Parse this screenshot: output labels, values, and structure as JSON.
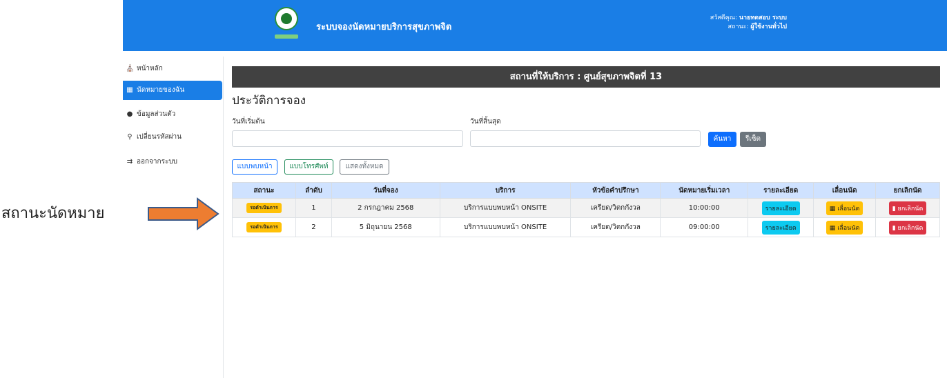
{
  "header": {
    "app_title": "ระบบจองนัดหมายบริการสุขภาพจิต",
    "greeting_label": "สวัสดีคุณ:",
    "user_name": "นายทดสอบ ระบบ",
    "status_label": "สถานะ:",
    "user_role": "ผู้ใช้งานทั่วไป",
    "brand_color": "#1a7ee6"
  },
  "sidebar": {
    "items": [
      {
        "label": "หน้าหลัก",
        "icon": "home-icon"
      },
      {
        "label": "นัดหมายของฉัน",
        "icon": "calendar-icon",
        "active": true
      },
      {
        "label": "ข้อมูลส่วนตัว",
        "icon": "user-icon"
      },
      {
        "label": "เปลี่ยนรหัสผ่าน",
        "icon": "key-icon"
      },
      {
        "label": "ออกจากระบบ",
        "icon": "logout-icon"
      }
    ]
  },
  "main": {
    "place_title": "สถานที่ให้บริการ : ศูนย์สุขภาพจิตที่ 13",
    "page_title": "ประวัติการจอง",
    "start_date_label": "วันที่เริ่มต้น",
    "end_date_label": "วันที่สิ้นสุด",
    "start_date_value": "",
    "end_date_value": "",
    "search_label": "ค้นหา",
    "reset_label": "รีเซ็ต",
    "filters": [
      "แบบพบหน้า",
      "แบบโทรศัพท์",
      "แสดงทั้งหมด"
    ]
  },
  "table": {
    "headers": [
      "สถานะ",
      "ลำดับ",
      "วันที่จอง",
      "บริการ",
      "หัวข้อคำปรึกษา",
      "นัดหมายเริ่มเวลา",
      "รายละเอียด",
      "เลื่อนนัด",
      "ยกเลิกนัด"
    ],
    "rows": [
      {
        "status": "รอดำเนินการ",
        "no": "1",
        "date": "2 กรกฎาคม 2568",
        "service": "บริการแบบพบหน้า ONSITE",
        "topic": "เครียด/วิตกกังวล",
        "time": "10:00:00",
        "detail": "รายละเอียด",
        "move": "เลื่อนนัด",
        "cancel": "ยกเลิกนัด"
      },
      {
        "status": "รอดำเนินการ",
        "no": "2",
        "date": "5 มิถุนายน 2568",
        "service": "บริการแบบพบหน้า ONSITE",
        "topic": "เครียด/วิตกกังวล",
        "time": "09:00:00",
        "detail": "รายละเอียด",
        "move": "เลื่อนนัด",
        "cancel": "ยกเลิกนัด"
      }
    ]
  },
  "annotation": {
    "label": "สถานะนัดหมาย",
    "arrow_color": "#ed7d31"
  }
}
